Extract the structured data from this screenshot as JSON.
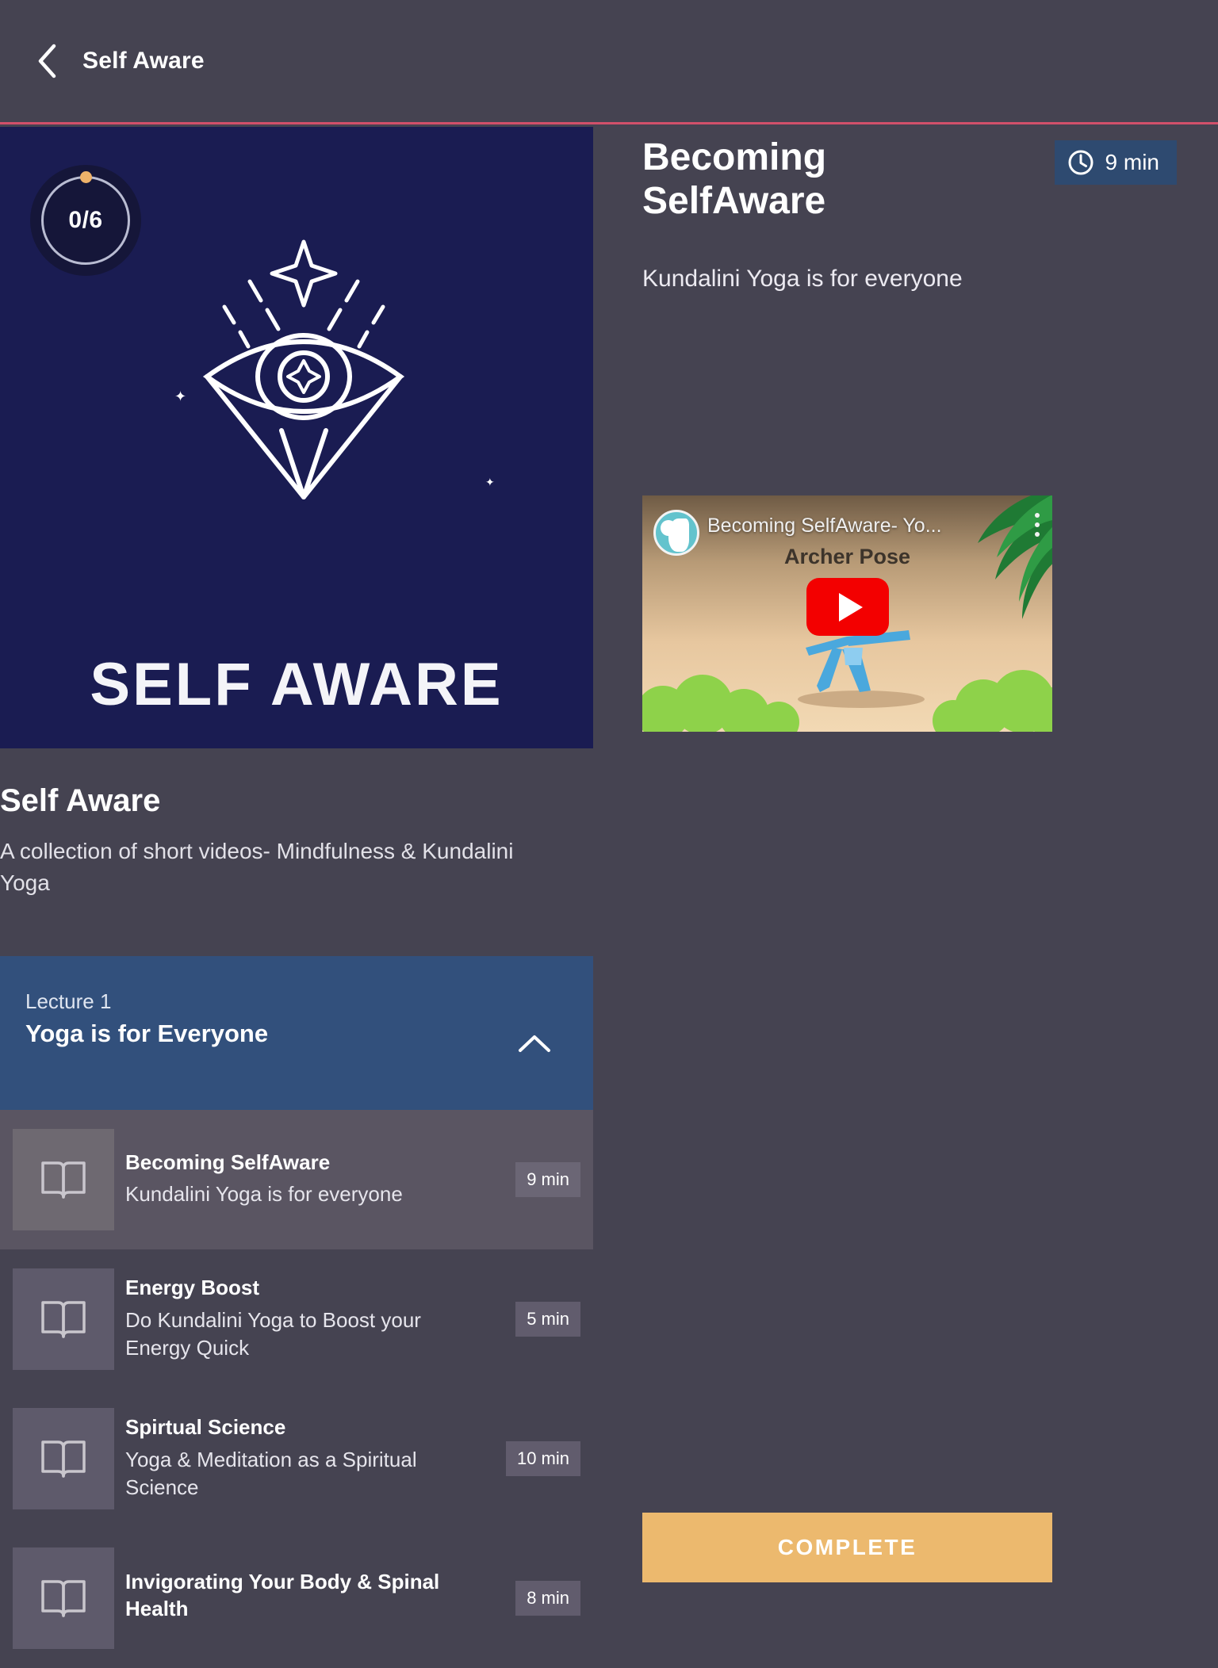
{
  "appbar": {
    "back_icon": "chevron-left-icon",
    "title": "Self Aware",
    "accent_color": "#d1506a"
  },
  "hero": {
    "progress_label": "0/6",
    "progress_completed": 0,
    "progress_total": 6,
    "wordmark": "SELF AWARE",
    "background_color": "#1a1c52",
    "dot_color": "#eeb26a",
    "art_icon": "all-seeing-eye-icon"
  },
  "course": {
    "title": "Self Aware",
    "description": "A collection of short videos- Mindfulness & Kundalini Yoga"
  },
  "lecture": {
    "kicker": "Lecture 1",
    "name": "Yoga is for Everyone",
    "collapse_icon": "chevron-up-icon",
    "background_color": "#32507c"
  },
  "lessons": [
    {
      "title": "Becoming SelfAware",
      "subtitle": "Kundalini Yoga is for everyone",
      "duration": "9 min",
      "icon": "book-icon",
      "active": true
    },
    {
      "title": "Energy Boost",
      "subtitle": "Do Kundalini Yoga to Boost your Energy Quick",
      "duration": "5 min",
      "icon": "book-icon",
      "active": false
    },
    {
      "title": "Spirtual Science",
      "subtitle": "Yoga & Meditation as a Spiritual Science",
      "duration": "10 min",
      "icon": "book-icon",
      "active": false
    },
    {
      "title": "Invigorating Your Body & Spinal Health",
      "subtitle": "",
      "duration": "8 min",
      "icon": "book-icon",
      "active": false
    }
  ],
  "detail": {
    "title": "Becoming SelfAware",
    "subtitle": "Kundalini Yoga is for everyone",
    "duration": "9 min",
    "clock_icon": "clock-icon",
    "chip_color": "#2e4a70"
  },
  "video": {
    "title": "Becoming SelfAware- Yo...",
    "overlay_text": "Archer Pose",
    "play_icon": "play-button-icon",
    "menu_icon": "kebab-menu-icon",
    "channel_icon": "moon-face-avatar-icon"
  },
  "footer": {
    "complete_label": "COMPLETE",
    "complete_color": "#ecb96e"
  }
}
